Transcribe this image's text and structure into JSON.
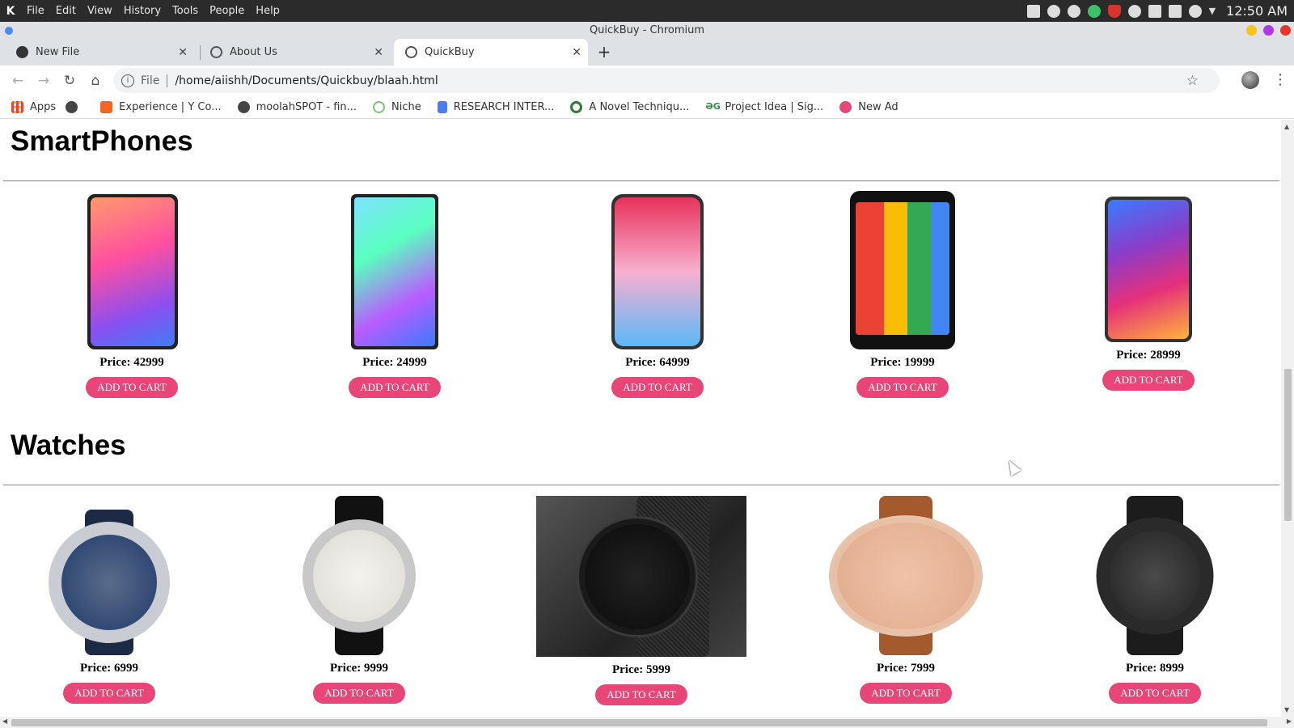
{
  "system_bar": {
    "menu": [
      "File",
      "Edit",
      "View",
      "History",
      "Tools",
      "People",
      "Help"
    ],
    "clock": "12:50 AM"
  },
  "window": {
    "title": "QuickBuy - Chromium"
  },
  "tabs": [
    {
      "label": "New File"
    },
    {
      "label": "About Us"
    },
    {
      "label": "QuickBuy",
      "active": true
    }
  ],
  "toolbar": {
    "scheme": "File",
    "url": "/home/aiishh/Documents/Quickbuy/blaah.html"
  },
  "bookmarks": [
    {
      "label": "Apps",
      "icon": "apps-grid-icon",
      "color": "#e94235"
    },
    {
      "label": "",
      "icon": "globe-icon",
      "color": "#555555"
    },
    {
      "label": "Experience | Y Co...",
      "icon": "ycombinator-icon",
      "color": "#f26522"
    },
    {
      "label": "moolahSPOT - fin...",
      "icon": "globe-icon",
      "color": "#555555"
    },
    {
      "label": "Niche",
      "icon": "niche-icon",
      "color": "#7bc67b"
    },
    {
      "label": "RESEARCH INTER...",
      "icon": "docs-icon",
      "color": "#4a7ef0"
    },
    {
      "label": "A Novel Techniqu...",
      "icon": "rings-icon",
      "color": "#2e7d32"
    },
    {
      "label": "Project Idea | Sig...",
      "icon": "gfg-icon",
      "color": "#2f8d46"
    },
    {
      "label": "New Ad",
      "icon": "newad-icon",
      "color": "#e84579"
    }
  ],
  "page": {
    "sections": [
      {
        "title": "SmartPhones",
        "items": [
          {
            "price_label": "Price: 42999",
            "button": "ADD TO CART"
          },
          {
            "price_label": "Price: 24999",
            "button": "ADD TO CART"
          },
          {
            "price_label": "Price: 64999",
            "button": "ADD TO CART"
          },
          {
            "price_label": "Price: 19999",
            "button": "ADD TO CART"
          },
          {
            "price_label": "Price: 28999",
            "button": "ADD TO CART"
          }
        ]
      },
      {
        "title": "Watches",
        "items": [
          {
            "price_label": "Price: 6999",
            "button": "ADD TO CART"
          },
          {
            "price_label": "Price: 9999",
            "button": "ADD TO CART"
          },
          {
            "price_label": "Price: 5999",
            "button": "ADD TO CART"
          },
          {
            "price_label": "Price: 7999",
            "button": "ADD TO CART"
          },
          {
            "price_label": "Price: 8999",
            "button": "ADD TO CART"
          }
        ]
      }
    ]
  },
  "colors": {
    "accent_button": "#e84579",
    "tab_strip": "#dee1e6"
  }
}
